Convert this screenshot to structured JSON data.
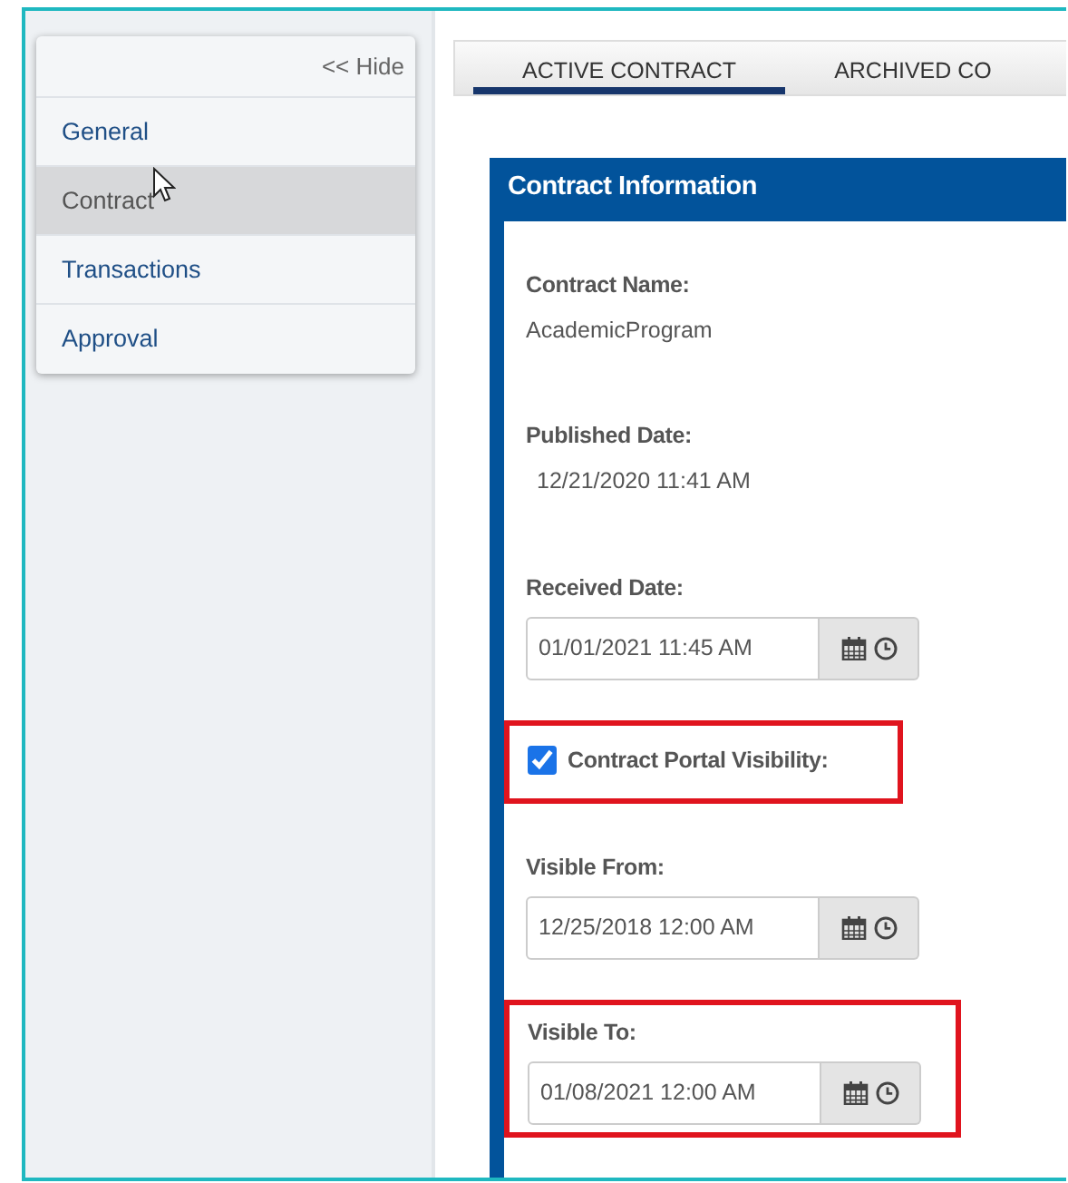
{
  "sidebar": {
    "hide_link": "<< Hide",
    "items": [
      {
        "label": "General",
        "selected": false
      },
      {
        "label": "Contract",
        "selected": true
      },
      {
        "label": "Transactions",
        "selected": false
      },
      {
        "label": "Approval",
        "selected": false
      }
    ]
  },
  "tabs": [
    {
      "label": "ACTIVE CONTRACT",
      "selected": true
    },
    {
      "label": "ARCHIVED CO",
      "selected": false
    }
  ],
  "panel": {
    "title": "Contract Information",
    "fields": [
      {
        "kind": "text",
        "label": "Contract Name:",
        "value": "AcademicProgram",
        "highlighted": false
      },
      {
        "kind": "text",
        "label": "Published Date:",
        "value": "12/21/2020 11:41 AM",
        "highlighted": false
      },
      {
        "kind": "datetime",
        "label": "Received Date:",
        "value": "01/01/2021 11:45 AM",
        "highlighted": false
      },
      {
        "kind": "checkbox",
        "label": "Contract Portal Visibility:",
        "checked": true,
        "highlighted": true
      },
      {
        "kind": "datetime",
        "label": "Visible From:",
        "value": "12/25/2018 12:00 AM",
        "highlighted": false
      },
      {
        "kind": "datetime",
        "label": "Visible To:",
        "value": "01/08/2021 12:00 AM",
        "highlighted": true
      }
    ]
  }
}
